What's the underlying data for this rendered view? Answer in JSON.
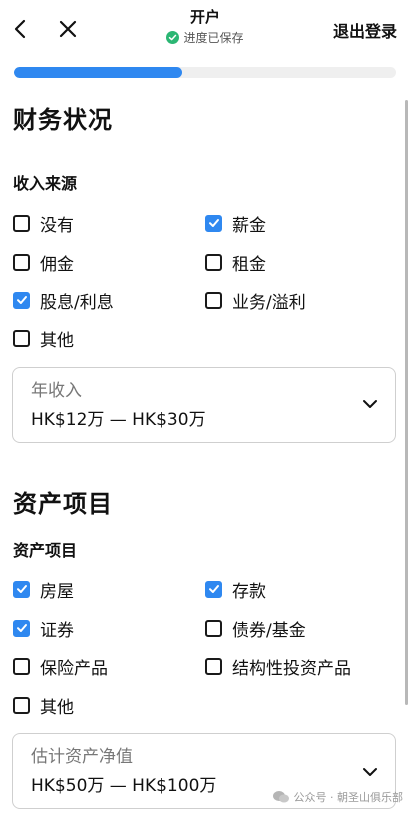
{
  "header": {
    "title": "开户",
    "saved_status": "进度已保存",
    "logout_label": "退出登录"
  },
  "progress": {
    "fraction": 0.44
  },
  "financial": {
    "section_title": "财务状况",
    "income_source": {
      "title": "收入来源",
      "options": [
        {
          "label": "没有",
          "checked": false
        },
        {
          "label": "薪金",
          "checked": true
        },
        {
          "label": "佣金",
          "checked": false
        },
        {
          "label": "租金",
          "checked": false
        },
        {
          "label": "股息/利息",
          "checked": true
        },
        {
          "label": "业务/溢利",
          "checked": false
        },
        {
          "label": "其他",
          "checked": false
        }
      ]
    },
    "annual_income": {
      "label": "年收入",
      "value": "HK$12万 — HK$30万"
    }
  },
  "assets": {
    "section_title": "资产项目",
    "items": {
      "title": "资产项目",
      "options": [
        {
          "label": "房屋",
          "checked": true
        },
        {
          "label": "存款",
          "checked": true
        },
        {
          "label": "证券",
          "checked": true
        },
        {
          "label": "债券/基金",
          "checked": false
        },
        {
          "label": "保险产品",
          "checked": false
        },
        {
          "label": "结构性投资产品",
          "checked": false
        },
        {
          "label": "其他",
          "checked": false
        }
      ]
    },
    "net_worth": {
      "label": "估计资产净值",
      "value": "HK$50万 — HK$100万"
    }
  },
  "watermark": {
    "text": "公众号 · 朝圣山俱乐部"
  },
  "colors": {
    "accent": "#2f88f0",
    "saved_green": "#2bb673"
  }
}
